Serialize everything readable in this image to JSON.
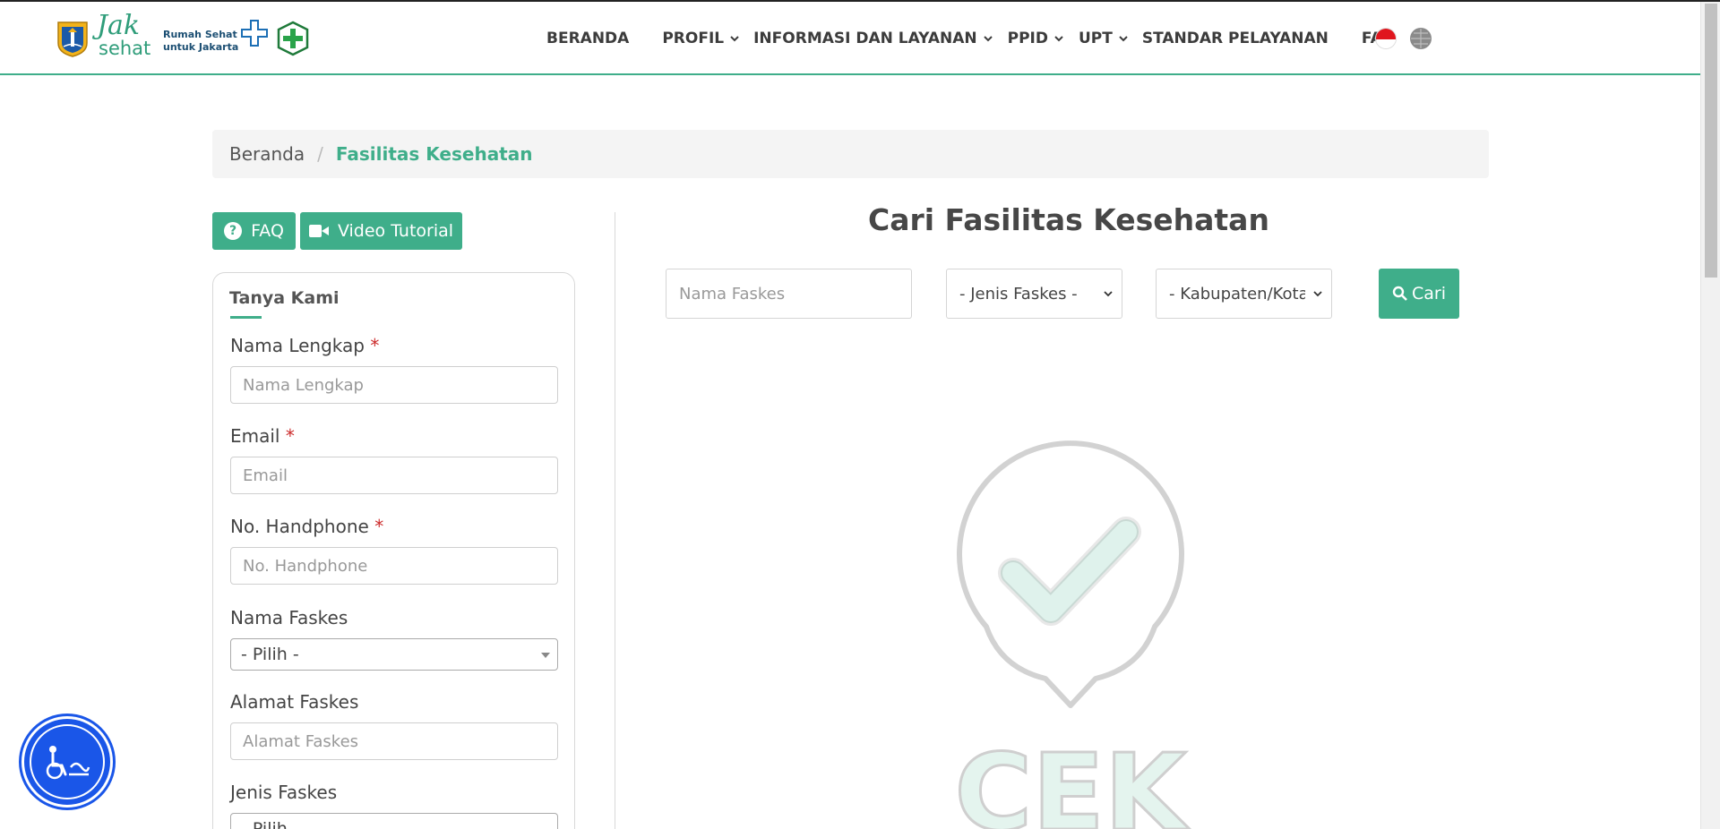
{
  "header": {
    "brand_line1": "Rumah Sehat",
    "brand_line2": "untuk Jakarta",
    "brand_jak": "Jak",
    "brand_sehat": "sehat",
    "nav": [
      {
        "label": "BERANDA",
        "has_dropdown": false
      },
      {
        "label": "PROFIL",
        "has_dropdown": true
      },
      {
        "label": "INFORMASI DAN LAYANAN",
        "has_dropdown": true
      },
      {
        "label": "PPID",
        "has_dropdown": true
      },
      {
        "label": "UPT",
        "has_dropdown": true
      },
      {
        "label": "STANDAR PELAYANAN",
        "has_dropdown": false
      },
      {
        "label": "FAQ",
        "has_dropdown": false
      }
    ]
  },
  "breadcrumb": {
    "home": "Beranda",
    "separator": "/",
    "current": "Fasilitas Kesehatan"
  },
  "actions": {
    "faq_label": "FAQ",
    "video_label": "Video Tutorial"
  },
  "form": {
    "title": "Tanya Kami",
    "required_mark": "*",
    "nama_label": "Nama Lengkap",
    "nama_placeholder": "Nama Lengkap",
    "email_label": "Email",
    "email_placeholder": "Email",
    "hp_label": "No. Handphone",
    "hp_placeholder": "No. Handphone",
    "faskes_label": "Nama Faskes",
    "faskes_value": "- Pilih -",
    "alamat_label": "Alamat Faskes",
    "alamat_placeholder": "Alamat Faskes",
    "jenis_label": "Jenis Faskes",
    "jenis_value": "- Pilih -"
  },
  "search": {
    "title": "Cari Fasilitas Kesehatan",
    "nama_placeholder": "Nama Faskes",
    "jenis_value": "- Jenis Faskes -",
    "kabupaten_value": "- Kabupaten/Kota -",
    "button_label": "Cari"
  },
  "illustration": {
    "text": "CEK"
  },
  "colors": {
    "accent": "#3fae8a",
    "accessibility": "#1a56e8",
    "required": "#cc2b2b"
  }
}
